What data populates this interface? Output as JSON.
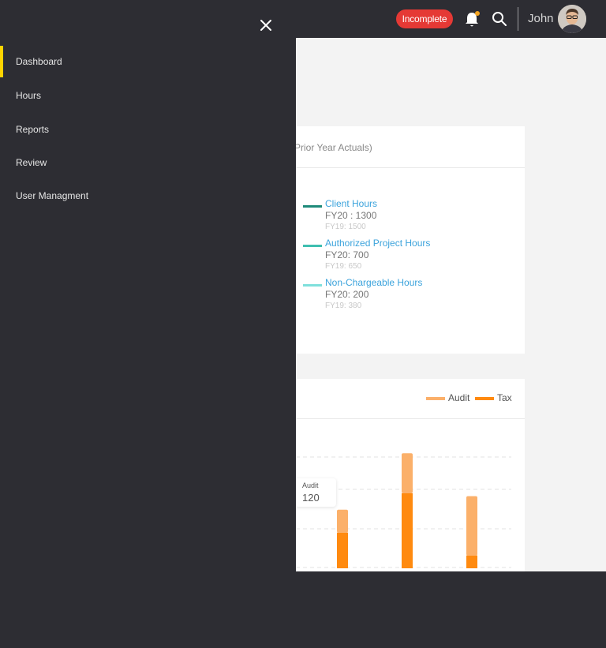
{
  "header": {
    "status_badge": "Incomplete",
    "user_name": "John",
    "icons": [
      "bell-icon",
      "search-icon"
    ],
    "notification_dot_color": "#f5a623"
  },
  "drawer": {
    "close_icon": "close-icon",
    "items": [
      {
        "label": "Dashboard",
        "active": true
      },
      {
        "label": "Hours",
        "active": false
      },
      {
        "label": "Reports",
        "active": false
      },
      {
        "label": "Review",
        "active": false
      },
      {
        "label": "User Managment",
        "active": false
      }
    ],
    "accent_color": "#ffd400"
  },
  "summary_card": {
    "title_fragment": "Prior Year Actuals)",
    "legend": [
      {
        "name": "Client Hours",
        "current": "FY20 : 1300",
        "prior": "FY19: 1500",
        "color": "#1e8a7a"
      },
      {
        "name": "Authorized Project Hours",
        "current": "FY20: 700",
        "prior": "FY19: 650",
        "color": "#3fbfb0"
      },
      {
        "name": "Non-Chargeable Hours",
        "current": "FY20: 200",
        "prior": "FY19: 380",
        "color": "#7fe0dc"
      }
    ]
  },
  "chart_card": {
    "legend": [
      {
        "name": "Audit",
        "color": "#fbb06a"
      },
      {
        "name": "Tax",
        "color": "#ff8a0f"
      }
    ],
    "tooltip": {
      "label": "Audit",
      "value": "120"
    }
  },
  "chart_data": {
    "type": "bar",
    "stacked": true,
    "categories": [
      "",
      "",
      ""
    ],
    "series": [
      {
        "name": "Tax",
        "values": [
          50,
          105,
          18
        ],
        "color": "#ff8a0f"
      },
      {
        "name": "Audit",
        "values": [
          32,
          56,
          83
        ],
        "color": "#fbb06a"
      }
    ],
    "ylim": [
      0,
      200
    ],
    "grid": true,
    "legend_position": "top-right"
  }
}
